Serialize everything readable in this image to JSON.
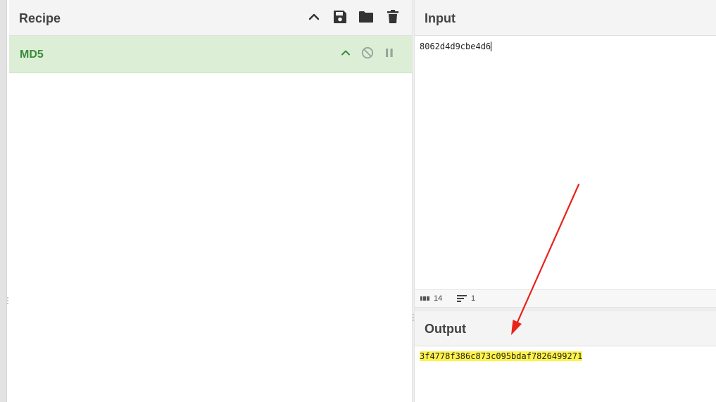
{
  "recipe": {
    "title": "Recipe",
    "header_icons": [
      "chevron-up-icon",
      "save-icon",
      "folder-icon",
      "trash-icon"
    ],
    "operations": [
      {
        "name": "MD5",
        "icons": [
          "chevron-up-icon",
          "disable-icon",
          "pause-icon"
        ]
      }
    ]
  },
  "input": {
    "title": "Input",
    "value": "8062d4d9cbe4d6",
    "status": {
      "length": "14",
      "lines": "1"
    }
  },
  "output": {
    "title": "Output",
    "value": "3f4778f386c873c095bdaf7826499271"
  },
  "colors": {
    "operation_bg": "#dcefd6",
    "operation_text": "#3c8a3e",
    "output_highlight": "#fff34a",
    "annotation_arrow": "#e8231a"
  }
}
